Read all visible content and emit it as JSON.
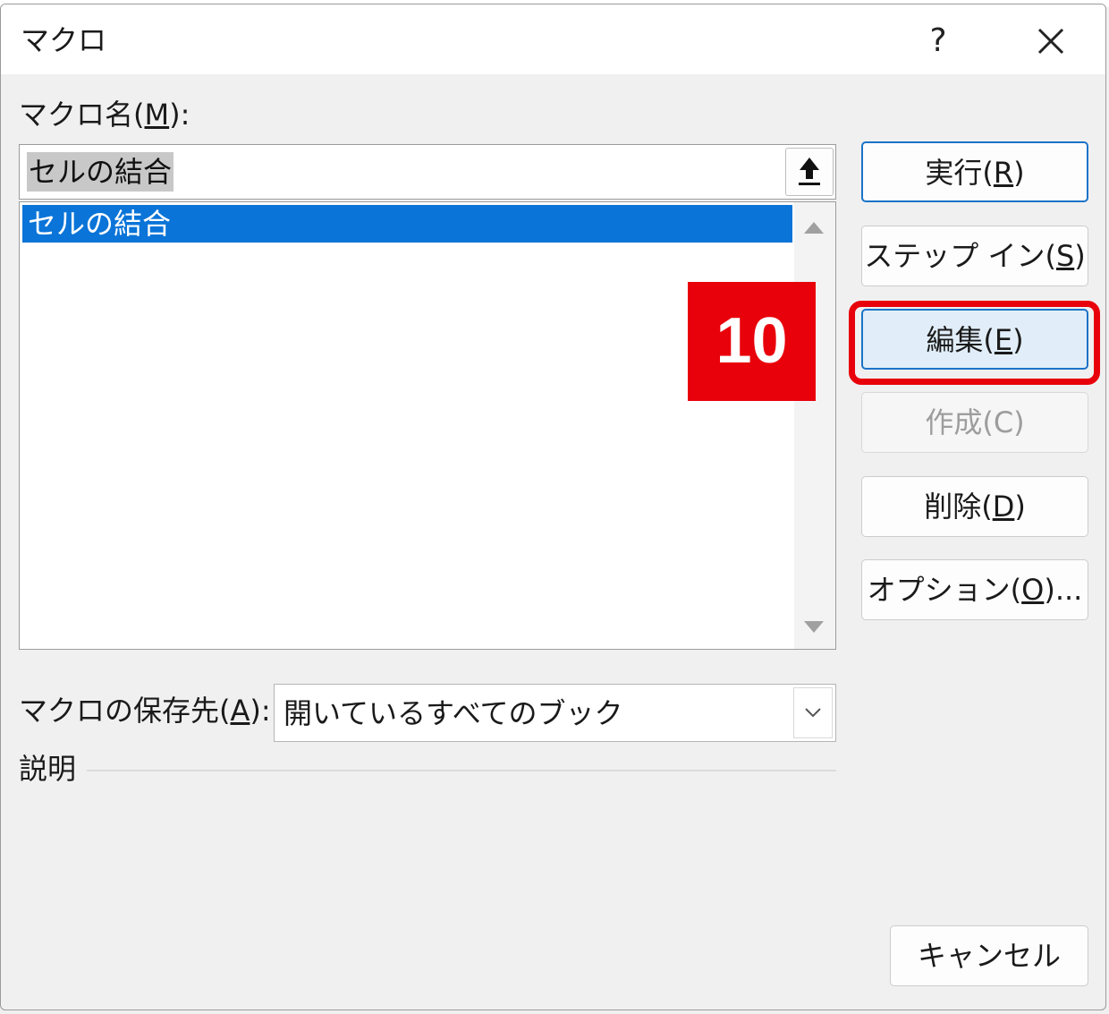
{
  "dialog": {
    "title": "マクロ",
    "help_label": "?"
  },
  "macro_name": {
    "label_pre": "マクロ名(",
    "label_key": "M",
    "label_post": "):",
    "value": "セルの結合"
  },
  "macro_list": {
    "items": [
      {
        "label": "セルの結合",
        "selected": true
      }
    ]
  },
  "step_badge": "10",
  "buttons": {
    "run": {
      "pre": "実行(",
      "key": "R",
      "post": ")"
    },
    "step_in": {
      "pre": "ステップ イン(",
      "key": "S",
      "post": ")"
    },
    "edit": {
      "pre": "編集(",
      "key": "E",
      "post": ")"
    },
    "create": {
      "label": "作成(C)"
    },
    "delete": {
      "pre": "削除(",
      "key": "D",
      "post": ")"
    },
    "options": {
      "pre": "オプション(",
      "key": "O",
      "post": ")..."
    },
    "cancel": {
      "label": "キャンセル"
    }
  },
  "store_in": {
    "label_pre": "マクロの保存先(",
    "label_key": "A",
    "label_post": "):",
    "value": "開いているすべてのブック"
  },
  "description": {
    "label": "説明"
  },
  "colors": {
    "highlight": "#e8000b",
    "selection": "#0a74d8",
    "focus_border": "#1b73c8"
  }
}
